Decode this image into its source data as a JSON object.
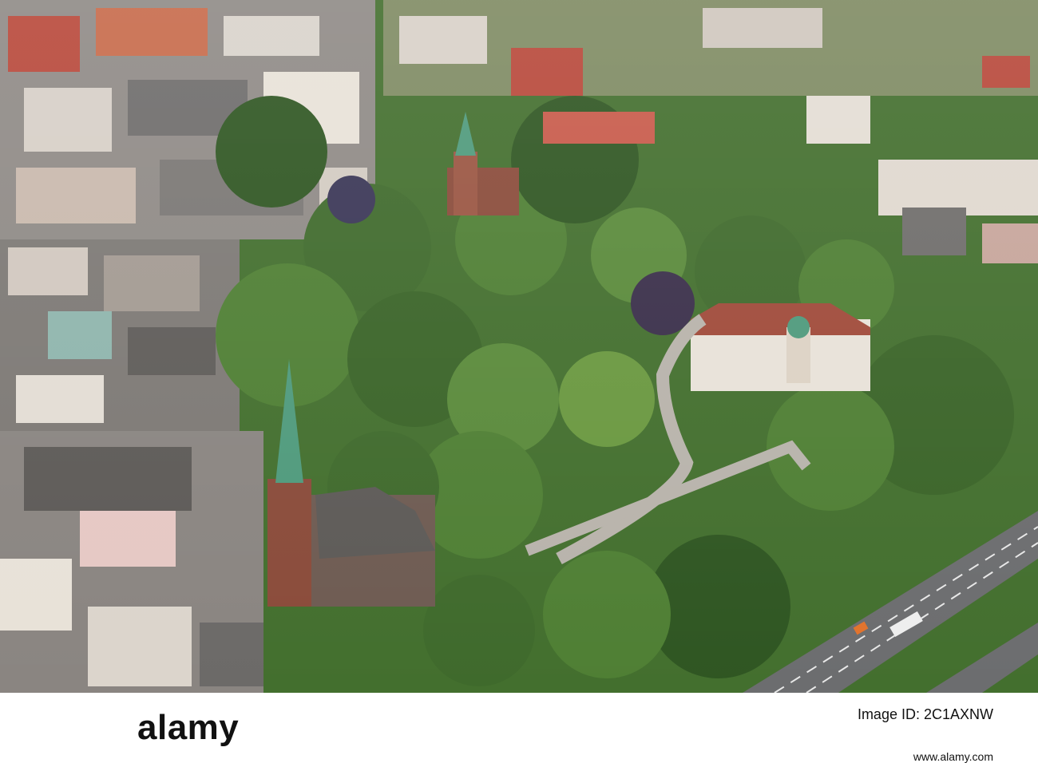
{
  "photo": {
    "description_alt": "",
    "palette": {
      "tree_dark": "#2f5622",
      "tree_mid": "#4f7f34",
      "tree_light": "#77a44a",
      "roof_red": "#b8483a",
      "roof_gray": "#6e6c6b",
      "church_brick": "#8a4b3a",
      "spire_copper": "#4f9a7c",
      "motorway": "#6c6d6f",
      "building_white": "#e8e2d8"
    }
  },
  "watermark": {
    "brand": "alamy",
    "id_label": "Image ID: 2C1AXNW",
    "id_value": "",
    "site": "www.alamy.com"
  }
}
